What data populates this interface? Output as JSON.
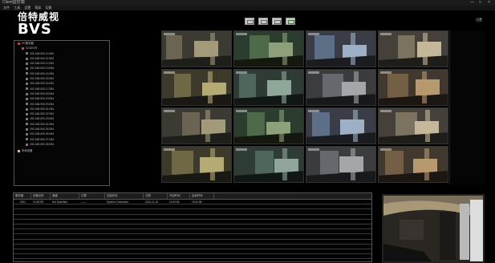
{
  "window": {
    "title": "Client监控端",
    "minimize": "—",
    "maximize": "□",
    "close": "×"
  },
  "menu": [
    "文件",
    "工具",
    "设置",
    "帮助",
    "切换"
  ],
  "logo": {
    "cn": "倍特威视",
    "en": "BVS"
  },
  "tree": {
    "root": "VC服务器",
    "group": "VCADVR",
    "cameras": [
      "192.168.000.10:064",
      "192.168.000.11:054",
      "192.168.000.12:054",
      "192.168.000.13:054",
      "192.168.000.14:054",
      "192.168.000.15:054",
      "192.168.000.16:054",
      "192.168.000.17:054",
      "192.168.000.18:054",
      "192.168.000.19:054",
      "192.168.000.20:054",
      "192.168.000.21:054",
      "192.168.000.22:054",
      "192.168.000.23:054",
      "192.168.000.24:054",
      "192.168.000.25:054",
      "192.168.000.26:054",
      "192.168.000.27:054",
      "192.168.000.28:054"
    ],
    "folder": "本地设备"
  },
  "toolbar": {
    "buttons": [
      "1画面",
      "4画面",
      "9画面",
      "16画面"
    ],
    "active_index": 3
  },
  "corner_label": "设置",
  "table": {
    "headers": [
      "服务器",
      "设备名称",
      "通道",
      "位置",
      "连接状态",
      "日期",
      "开始时间",
      "结束时间"
    ],
    "rows": [
      [
        "0001",
        "VCADVR",
        "Not Specified",
        "——",
        "System Connected",
        "2016-11-16",
        "15:40:58",
        "15:40:58"
      ]
    ]
  },
  "colors": {
    "accent_on": "#b8d9b0",
    "tree_root": "#dd3333",
    "background": "#000000"
  }
}
